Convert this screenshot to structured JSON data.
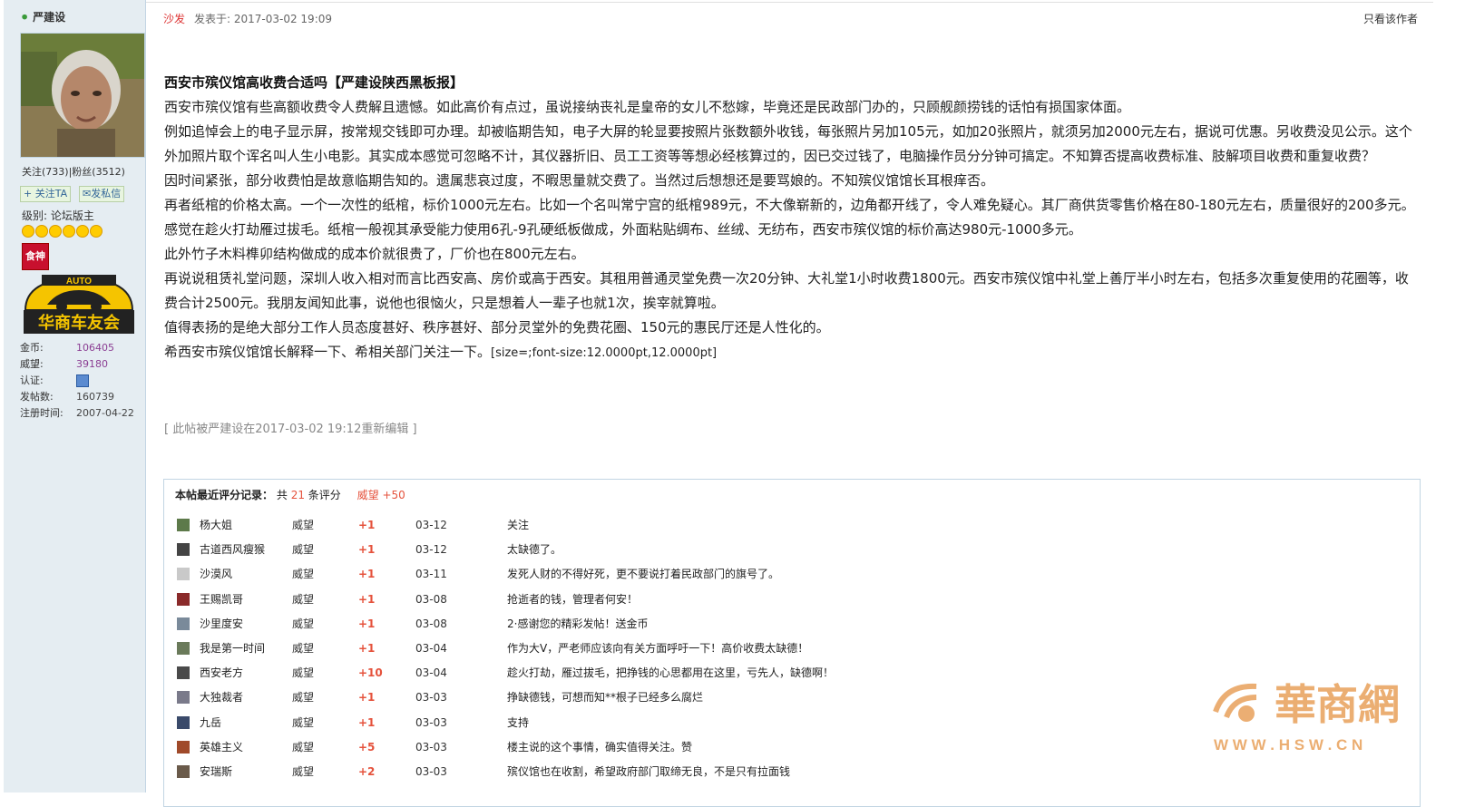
{
  "sidebar": {
    "username": "严建设",
    "follow_stats": "关注(733)|粉丝(3512)",
    "follow_button": "+ 关注TA",
    "message_button": "发私信",
    "level": "级别: 论坛版主",
    "medal_text": "食神",
    "badge_top": "AUTO",
    "badge_text": "华商车友会",
    "stats": [
      {
        "label": "金币:",
        "value": "106405"
      },
      {
        "label": "威望:",
        "value": "39180"
      },
      {
        "label": "认证:",
        "value": ""
      },
      {
        "label": "发帖数:",
        "value": "160739"
      },
      {
        "label": "注册时间:",
        "value": "2007-04-22"
      }
    ]
  },
  "post": {
    "sofa": "沙发",
    "time": "发表于: 2017-03-02 19:09",
    "only_author": "只看该作者",
    "title": "西安市殡仪馆高收费合适吗【严建设陕西黑板报】",
    "paragraphs": [
      "西安市殡仪馆有些高额收费令人费解且遗憾。如此高价有点过，虽说接纳丧礼是皇帝的女儿不愁嫁，毕竟还是民政部门办的，只顾舰颜捞钱的话怕有损国家体面。",
      "例如追悼会上的电子显示屏，按常规交钱即可办理。却被临期告知，电子大屏的轮显要按照片张数额外收钱，每张照片另加105元，如加20张照片，就须另加2000元左右，据说可优惠。另收费没见公示。这个外加照片取个诨名叫人生小电影。其实成本感觉可忽略不计，其仪器折旧、员工工资等等想必经核算过的，因已交过钱了，电脑操作员分分钟可搞定。不知算否提高收费标准、肢解项目收费和重复收费？",
      "因时间紧张，部分收费怕是故意临期告知的。遗属悲哀过度，不暇思量就交费了。当然过后想想还是要骂娘的。不知殡仪馆馆长耳根痒否。",
      "再者纸棺的价格太高。一个一次性的纸棺，标价1000元左右。比如一个名叫常宁宫的纸棺989元，不大像崭新的，边角都开线了，令人难免疑心。其厂商供货零售价格在80-180元左右，质量很好的200多元。感觉在趁火打劫雁过拔毛。纸棺一般视其承受能力使用6孔-9孔硬纸板做成，外面粘贴绸布、丝绒、无纺布，西安市殡仪馆的标价高达980元-1000多元。",
      "此外竹子木料榫卯结构做成的成本价就很贵了，厂价也在800元左右。",
      "再说说租赁礼堂问题，深圳人收入相对而言比西安高、房价或高于西安。其租用普通灵堂免费一次20分钟、大礼堂1小时收费1800元。西安市殡仪馆中礼堂上善厅半小时左右，包括多次重复使用的花圈等，收费合计2500元。我朋友闻知此事，说他也很恼火，只是想着人一辈子也就1次，挨宰就算啦。",
      "值得表扬的是绝大部分工作人员态度甚好、秩序甚好、部分灵堂外的免费花圈、150元的惠民厅还是人性化的。",
      "希西安市殡仪馆馆长解释一下、希相关部门关注一下。"
    ],
    "code_tail": "[size=;font-size:12.0000pt,12.0000pt]",
    "edit_note": "[ 此帖被严建设在2017-03-02 19:12重新编辑 ]"
  },
  "ratings": {
    "title": "本帖最近评分记录：",
    "total_prefix": "共",
    "total_count": "21",
    "total_suffix": "条评分",
    "weiwang_label": "威望",
    "weiwang_value": "+50",
    "rows": [
      {
        "name": "杨大姐",
        "type": "威望",
        "score": "+1",
        "date": "03-12",
        "reason": "关注"
      },
      {
        "name": "古道西风瘦猴",
        "type": "威望",
        "score": "+1",
        "date": "03-12",
        "reason": "太缺德了。"
      },
      {
        "name": "沙漠风",
        "type": "威望",
        "score": "+1",
        "date": "03-11",
        "reason": "发死人财的不得好死，更不要说打着民政部门的旗号了。"
      },
      {
        "name": "王赐凯哥",
        "type": "威望",
        "score": "+1",
        "date": "03-08",
        "reason": "抢逝者的钱，管理者何安！"
      },
      {
        "name": "沙里度安",
        "type": "威望",
        "score": "+1",
        "date": "03-08",
        "reason": "2·感谢您的精彩发帖！送金币"
      },
      {
        "name": "我是第一时间",
        "type": "威望",
        "score": "+1",
        "date": "03-04",
        "reason": "作为大V，严老师应该向有关方面呼吁一下！高价收费太缺德！"
      },
      {
        "name": "西安老方",
        "type": "威望",
        "score": "+10",
        "date": "03-04",
        "reason": "趁火打劫，雁过拔毛，把挣钱的心思都用在这里，亏先人，缺德啊！"
      },
      {
        "name": "大独裁者",
        "type": "威望",
        "score": "+1",
        "date": "03-03",
        "reason": "挣缺德钱，可想而知**根子已经多么腐烂"
      },
      {
        "name": "九岳",
        "type": "威望",
        "score": "+1",
        "date": "03-03",
        "reason": "支持"
      },
      {
        "name": "英雄主义",
        "type": "威望",
        "score": "+5",
        "date": "03-03",
        "reason": "楼主说的这个事情，确实值得关注。赞"
      },
      {
        "name": "安瑞斯",
        "type": "威望",
        "score": "+2",
        "date": "03-03",
        "reason": "殡仪馆也在收割，希望政府部门取缔无良，不是只有拉面钱"
      }
    ]
  },
  "watermark": {
    "logo": "華商網",
    "url": "W W W . H S W . C N"
  }
}
